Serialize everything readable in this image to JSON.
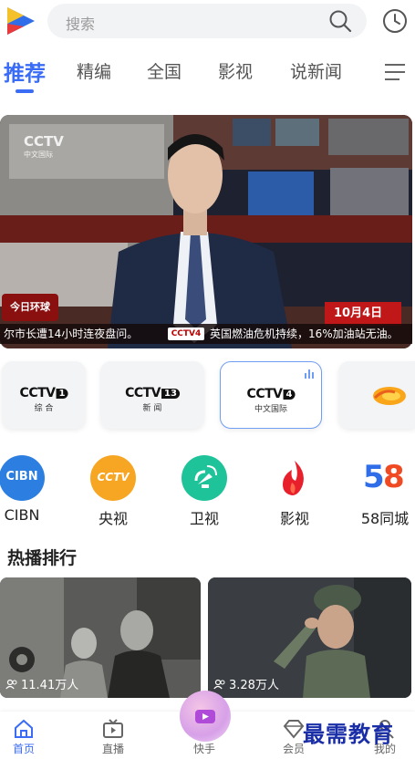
{
  "search": {
    "placeholder": "搜索"
  },
  "tabs": [
    {
      "label": "推荐",
      "active": true
    },
    {
      "label": "精编"
    },
    {
      "label": "全国"
    },
    {
      "label": "影视"
    },
    {
      "label": "说新闻"
    }
  ],
  "hero": {
    "bug_logo": "CCTV",
    "bug_sub": "中文国际",
    "corner_label": "今日环球",
    "date": "10月4日",
    "ticker_left": "尔市长遭14小时连夜盘问。",
    "ticker_logo": "CCTV4",
    "ticker_right": "英国燃油危机持续，16%加油站无油。"
  },
  "channels": [
    {
      "logo": "CCTV",
      "num": "1",
      "sub": "综 合"
    },
    {
      "logo": "CCTV",
      "num": "13",
      "sub": "新 闻"
    },
    {
      "logo": "CCTV",
      "num": "4",
      "sub": "中文国际",
      "selected": true
    }
  ],
  "categories": [
    {
      "label": "CIBN",
      "icon": "cibn-icon",
      "color": "#2c7fe0"
    },
    {
      "label": "央视",
      "icon": "cctv-icon",
      "color": "#f6a623"
    },
    {
      "label": "卫视",
      "icon": "satellite-icon",
      "color": "#1fc39a"
    },
    {
      "label": "影视",
      "icon": "flame-icon",
      "color": "#e8202c"
    },
    {
      "label": "58同城",
      "icon": "58-icon",
      "color": "#f08020"
    }
  ],
  "cat_circle_text": {
    "cibn": "CIBN",
    "cctv": "CCTV",
    "five": "5",
    "eight": "8"
  },
  "section": {
    "title": "热播排行"
  },
  "videos": [
    {
      "views": "11.41万人"
    },
    {
      "views": "3.28万人"
    }
  ],
  "nav": [
    {
      "label": "首页",
      "active": true
    },
    {
      "label": "直播"
    },
    {
      "label": "快手"
    },
    {
      "label": "会员"
    },
    {
      "label": "我的"
    }
  ],
  "watermark": "最需教育",
  "colors": {
    "accent": "#3b6cf6"
  }
}
